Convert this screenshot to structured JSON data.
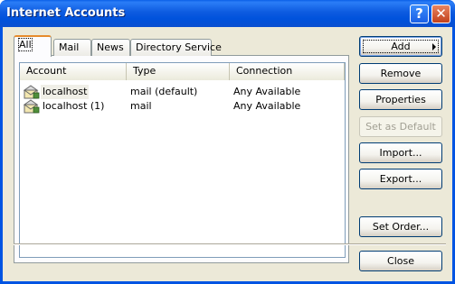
{
  "window": {
    "title": "Internet Accounts"
  },
  "title_buttons": {
    "help": "?",
    "close": "✕"
  },
  "tabs": [
    {
      "label": "All"
    },
    {
      "label": "Mail"
    },
    {
      "label": "News"
    },
    {
      "label": "Directory Service"
    }
  ],
  "list": {
    "columns": [
      "Account",
      "Type",
      "Connection"
    ],
    "rows": [
      {
        "account": "localhost",
        "type": "mail (default)",
        "connection": "Any Available"
      },
      {
        "account": "localhost (1)",
        "type": "mail",
        "connection": "Any Available"
      }
    ]
  },
  "buttons": {
    "add": "Add",
    "remove": "Remove",
    "properties": "Properties",
    "set_default": "Set as Default",
    "import": "Import...",
    "export": "Export...",
    "set_order": "Set Order...",
    "close": "Close"
  },
  "icons": {
    "account": "mail-account-icon",
    "add_arrow": "submenu-arrow-icon"
  },
  "colors": {
    "titlebar": "#0054e3",
    "tab_accent": "#e68b2c",
    "dialog_bg": "#ece9d8"
  }
}
